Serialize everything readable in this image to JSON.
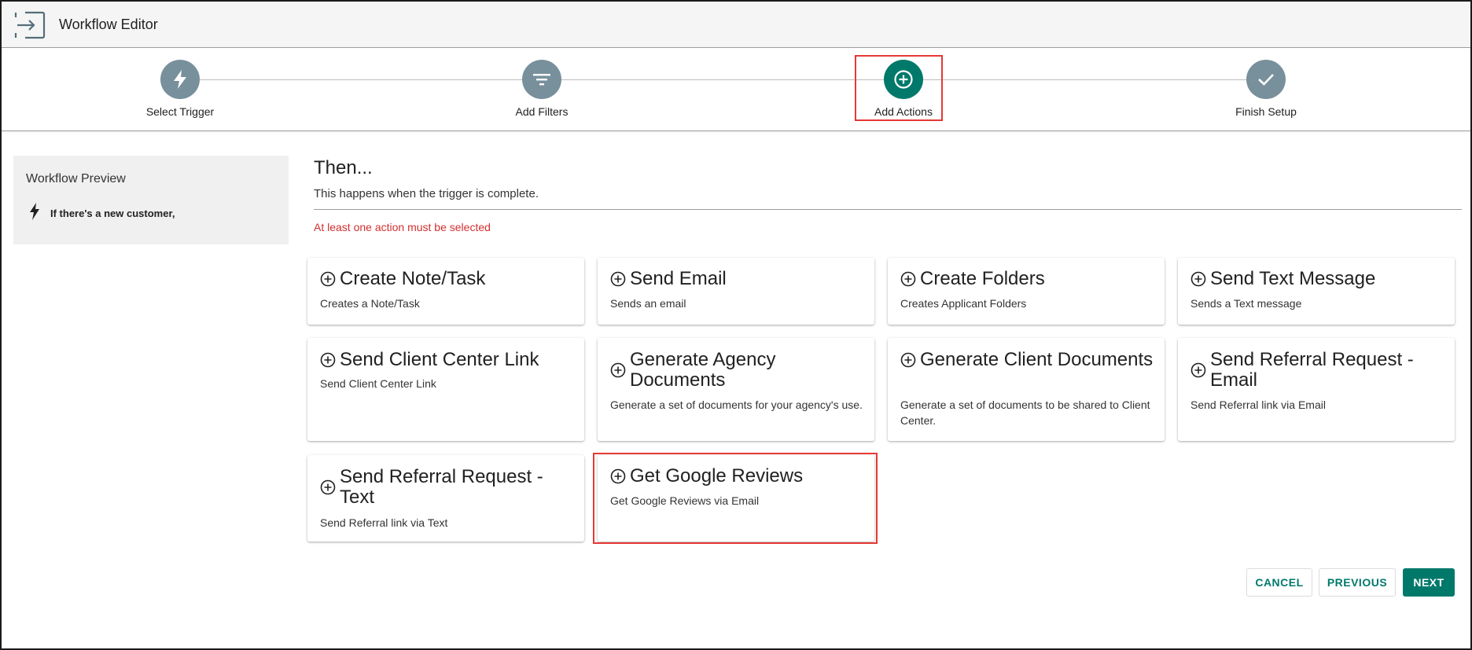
{
  "header": {
    "title": "Workflow Editor",
    "icon": "exit-to-app-icon"
  },
  "stepper": {
    "steps": [
      {
        "label": "Select Trigger",
        "icon": "bolt-icon",
        "active": false
      },
      {
        "label": "Add Filters",
        "icon": "filter-icon",
        "active": false
      },
      {
        "label": "Add Actions",
        "icon": "add-circle-icon",
        "active": true
      },
      {
        "label": "Finish Setup",
        "icon": "check-icon",
        "active": false
      }
    ],
    "active_color": "#00796b",
    "inactive_color": "#78909c"
  },
  "preview": {
    "title": "Workflow Preview",
    "trigger_text": "If there's a new customer,"
  },
  "main": {
    "title": "Then...",
    "subtitle": "This happens when the trigger is complete.",
    "error": "At least one action must be selected"
  },
  "actions": [
    {
      "title": "Create Note/Task",
      "description": "Creates a Note/Task"
    },
    {
      "title": "Send Email",
      "description": "Sends an email"
    },
    {
      "title": "Create Folders",
      "description": "Creates Applicant Folders"
    },
    {
      "title": "Send Text Message",
      "description": "Sends a Text message"
    },
    {
      "title": "Send Client Center Link",
      "description": "Send Client Center Link"
    },
    {
      "title": "Generate Agency Documents",
      "description": "Generate a set of documents for your agency's use."
    },
    {
      "title": "Generate Client Documents",
      "description": "Generate a set of documents to be shared to Client Center."
    },
    {
      "title": "Send Referral Request - Email",
      "description": "Send Referral link via Email"
    },
    {
      "title": "Send Referral Request - Text",
      "description": "Send Referral link via Text"
    },
    {
      "title": "Get Google Reviews",
      "description": "Get Google Reviews via Email"
    }
  ],
  "buttons": {
    "cancel": "CANCEL",
    "previous": "PREVIOUS",
    "next": "NEXT"
  },
  "colors": {
    "accent": "#00796b",
    "error": "#d32f2f",
    "highlight": "#e53935"
  }
}
